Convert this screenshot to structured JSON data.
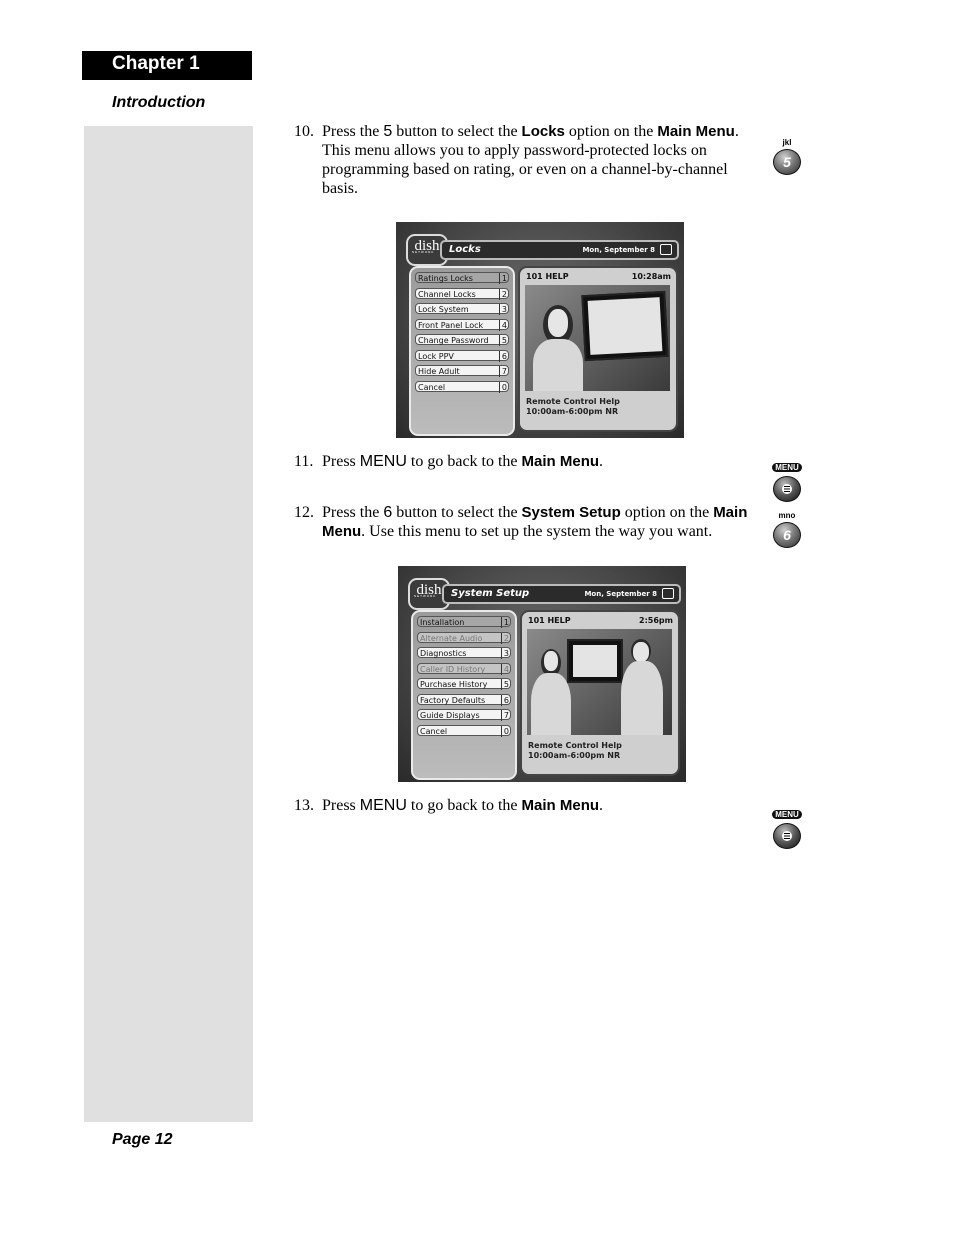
{
  "header": {
    "chapter": "Chapter 1",
    "section": "Introduction"
  },
  "footer": {
    "page": "Page 12"
  },
  "steps": [
    {
      "number": "10.",
      "parts": [
        "Press the ",
        "5",
        " button to select the ",
        "Locks",
        " option on the ",
        "Main Menu",
        ". This menu allows you to apply password-protected locks on programming based on rating, or even on a channel-by-channel basis."
      ],
      "remote_key": {
        "label": "jkl",
        "glyph": "5",
        "icon": "remote-5-button-icon"
      }
    },
    {
      "number": "11.",
      "parts": [
        "Press ",
        "MENU",
        " to go back to the ",
        "Main Menu",
        "."
      ],
      "remote_key": {
        "label": "MENU",
        "icon": "remote-menu-button-icon"
      }
    },
    {
      "number": "12.",
      "parts": [
        "Press the ",
        "6",
        " button to select the ",
        "System Setup",
        " option on the ",
        "Main Menu",
        ". Use this menu to set up the system the way you want."
      ],
      "remote_key": {
        "label": "mno",
        "glyph": "6",
        "icon": "remote-6-button-icon"
      }
    },
    {
      "number": "13.",
      "parts": [
        "Press ",
        "MENU",
        " to go back to the ",
        "Main Menu",
        "."
      ],
      "remote_key": {
        "label": "MENU",
        "icon": "remote-menu-button-icon"
      }
    }
  ],
  "screens": [
    {
      "logo": "dish",
      "logo_sub": "NETWORK",
      "title": "Locks",
      "date": "Mon, September 8",
      "menu_items": [
        {
          "label": "Ratings Locks",
          "key": "1",
          "state": "selected"
        },
        {
          "label": "Channel Locks",
          "key": "2",
          "state": "normal"
        },
        {
          "label": "Lock System",
          "key": "3",
          "state": "normal"
        },
        {
          "label": "Front Panel Lock",
          "key": "4",
          "state": "normal"
        },
        {
          "label": "Change Password",
          "key": "5",
          "state": "normal"
        },
        {
          "label": "Lock PPV",
          "key": "6",
          "state": "normal"
        },
        {
          "label": "Hide Adult",
          "key": "7",
          "state": "normal"
        },
        {
          "label": "Cancel",
          "key": "0",
          "state": "normal"
        }
      ],
      "help": {
        "channel": "101 HELP",
        "time": "10:28am",
        "program": "Remote Control Help",
        "schedule": "10:00am-6:00pm NR"
      }
    },
    {
      "logo": "dish",
      "logo_sub": "NETWORK",
      "title": "System Setup",
      "date": "Mon, September 8",
      "menu_items": [
        {
          "label": "Installation",
          "key": "1",
          "state": "selected"
        },
        {
          "label": "Alternate Audio",
          "key": "2",
          "state": "disabled"
        },
        {
          "label": "Diagnostics",
          "key": "3",
          "state": "normal"
        },
        {
          "label": "Caller ID History",
          "key": "4",
          "state": "disabled"
        },
        {
          "label": "Purchase History",
          "key": "5",
          "state": "normal"
        },
        {
          "label": "Factory Defaults",
          "key": "6",
          "state": "normal"
        },
        {
          "label": "Guide Displays",
          "key": "7",
          "state": "normal"
        },
        {
          "label": "Cancel",
          "key": "0",
          "state": "normal"
        }
      ],
      "help": {
        "channel": "101 HELP",
        "time": "2:56pm",
        "program": "Remote Control Help",
        "schedule": "10:00am-6:00pm NR"
      }
    }
  ]
}
